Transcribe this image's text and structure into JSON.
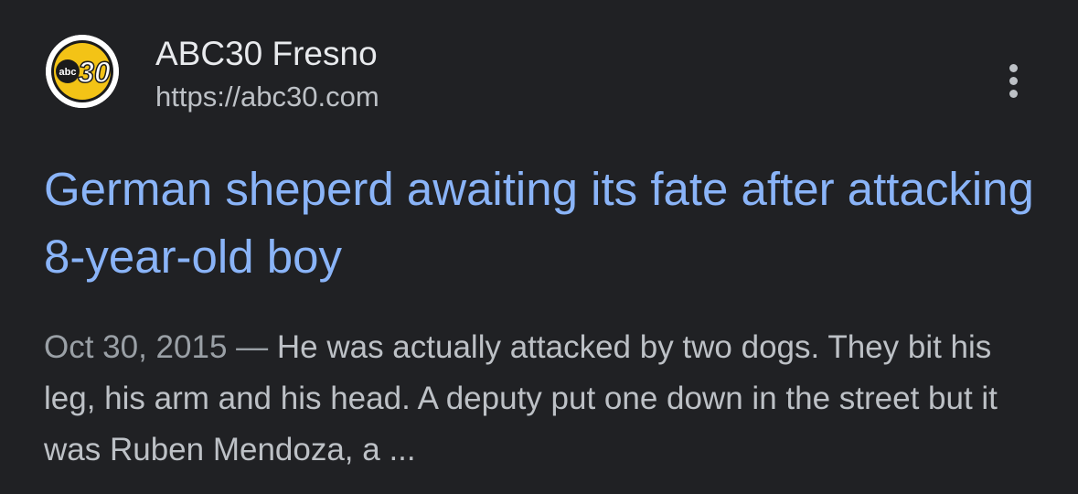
{
  "source": {
    "name": "ABC30 Fresno",
    "url": "https://abc30.com",
    "favicon": {
      "icon": "abc30-logo-icon",
      "abc_text": "abc",
      "number_text": "30",
      "colors": {
        "outer": "#ffffff",
        "yellow": "#f3c316",
        "black": "#1b1b1b"
      }
    }
  },
  "more_menu_icon": "more-vert-icon",
  "result": {
    "title": "German sheperd awaiting its fate after attacking 8-year-old boy",
    "date": "Oct 30, 2015",
    "separator": " — ",
    "snippet": "He was actually attacked by two dogs. They bit his leg, his arm and his head. A deputy put one down in the street but it was Ruben Mendoza, a ..."
  },
  "colors": {
    "background": "#202124",
    "title": "#8ab4f8",
    "site_name": "#e8eaed",
    "url": "#bdc1c6",
    "snippet": "#bdc1c6",
    "date": "#9aa0a6"
  }
}
